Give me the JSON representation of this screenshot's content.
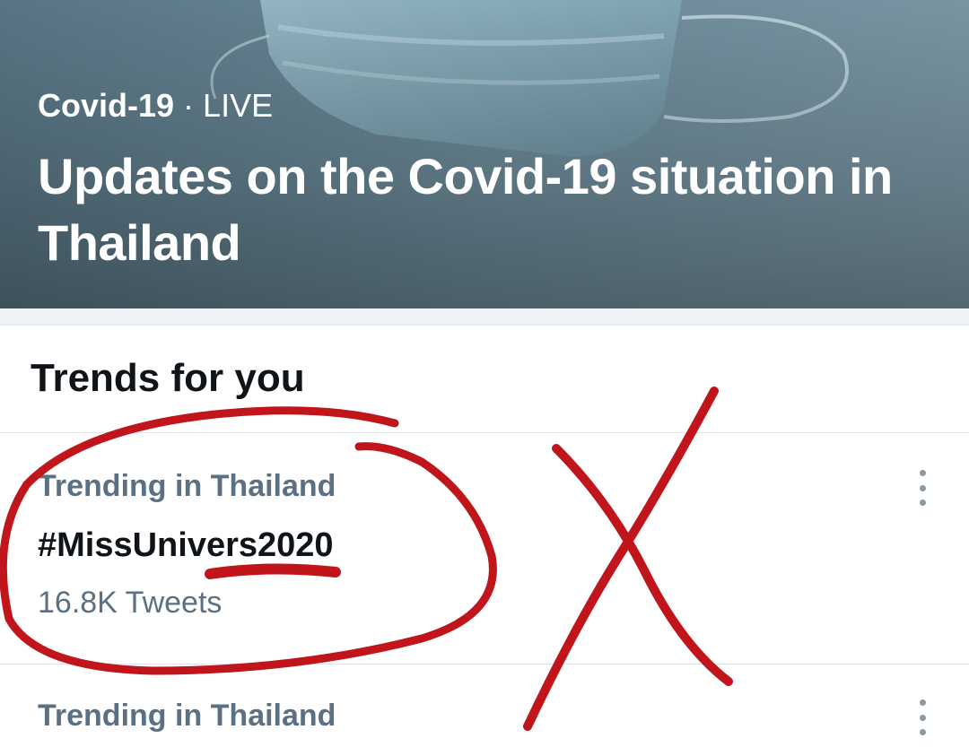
{
  "hero": {
    "topic": "Covid-19",
    "separator": "·",
    "status": "LIVE",
    "title": "Updates on the Covid-19 situation in Thailand"
  },
  "trends_section": {
    "title": "Trends for you",
    "items": [
      {
        "context": "Trending in Thailand",
        "name": "#MissUnivers2020",
        "count": "16.8K Tweets"
      },
      {
        "context": "Trending in Thailand"
      }
    ]
  },
  "icons": {
    "more": "more-vertical-icon"
  },
  "colors": {
    "annotation_ink": "#c0161b",
    "secondary_text": "#5b7083",
    "primary_text": "#0f1419"
  }
}
